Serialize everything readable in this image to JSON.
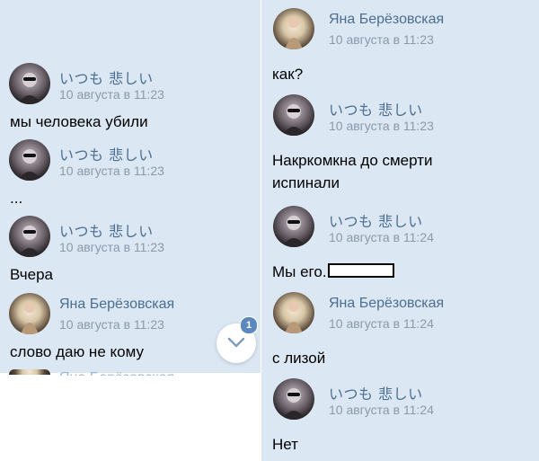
{
  "left_panel": {
    "messages": [
      {
        "sender": "いつも 悲しい",
        "date": "10 августа в 11:23",
        "text": "мы человека убили"
      },
      {
        "sender": "いつも 悲しい",
        "date": "10 августа в 11:23",
        "text": "..."
      },
      {
        "sender": "いつも 悲しい",
        "date": "10 августа в 11:23",
        "text": "Вчера"
      },
      {
        "sender": "Яна Берёзовская",
        "date": "10 августа в 11:23",
        "text": "слово даю не кому"
      }
    ],
    "partial_sender": "Яна Берёзовская"
  },
  "right_panel": {
    "messages": [
      {
        "sender": "Яна Берёзовская",
        "date": "10 августа в 11:23",
        "text": "как?"
      },
      {
        "sender": "いつも 悲しい",
        "date": "10 августа в 11:23",
        "text_line1": "Накркомкна до смерти",
        "text_line2": "испинали"
      },
      {
        "sender": "いつも 悲しい",
        "date": "10 августа в 11:24",
        "text": "Мы его."
      },
      {
        "sender": "Яна Берёзовская",
        "date": "10 августа в 11:24",
        "text": "с лизой"
      },
      {
        "sender": "いつも 悲しい",
        "date": "10 августа в 11:24",
        "text": "Нет"
      }
    ]
  },
  "scroll_button": {
    "icon": "chevron-down-icon",
    "unread_count": "1"
  },
  "colors": {
    "background": "#dbe7f3",
    "sender_name": "#4c6e90",
    "date": "#8a9aa8",
    "badge": "#5b88bd"
  }
}
